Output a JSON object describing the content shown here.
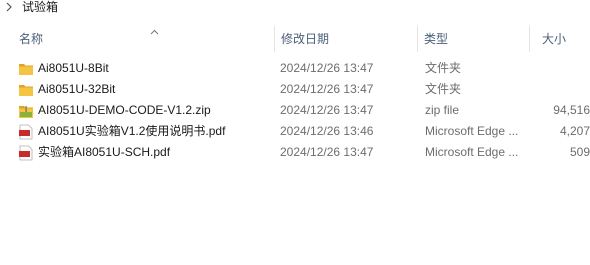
{
  "breadcrumb": {
    "label": "试验箱"
  },
  "columns": {
    "name": "名称",
    "date": "修改日期",
    "type": "类型",
    "size": "大小"
  },
  "colors": {
    "folder": "#f6c443",
    "folder_dark": "#e0a51f",
    "zip": "#8ab23d",
    "pdf": "#c62c2c",
    "header_text": "#4c607a",
    "meta_text": "#6d6d6d"
  },
  "files": [
    {
      "icon": "folder-icon",
      "name": "Ai8051U-8Bit",
      "date": "2024/12/26 13:47",
      "type": "文件夹",
      "size": ""
    },
    {
      "icon": "folder-icon",
      "name": "Ai8051U-32Bit",
      "date": "2024/12/26 13:47",
      "type": "文件夹",
      "size": ""
    },
    {
      "icon": "zip-icon",
      "name": "AI8051U-DEMO-CODE-V1.2.zip",
      "date": "2024/12/26 13:47",
      "type": "zip file",
      "size": "94,516"
    },
    {
      "icon": "pdf-icon",
      "name": "AI8051U实验箱V1.2使用说明书.pdf",
      "date": "2024/12/26 13:46",
      "type": "Microsoft Edge ...",
      "size": "4,207"
    },
    {
      "icon": "pdf-icon",
      "name": "实验箱AI8051U-SCH.pdf",
      "date": "2024/12/26 13:47",
      "type": "Microsoft Edge ...",
      "size": "509"
    }
  ]
}
